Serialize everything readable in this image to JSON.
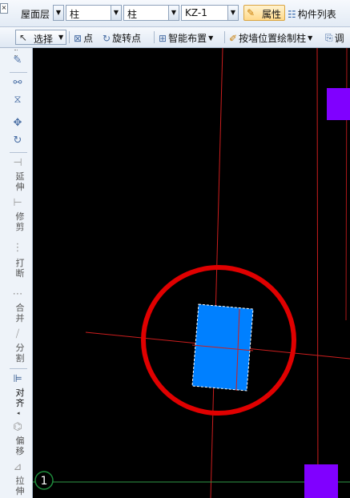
{
  "toolbar_top": {
    "floor": "屋面层",
    "category": "柱",
    "type": "柱",
    "element": "KZ-1",
    "properties": "属性",
    "component_list": "构件列表"
  },
  "toolbar_draw": {
    "select": "选择",
    "point": "点",
    "rotate_point": "旋转点",
    "smart_layout": "智能布置",
    "draw_by_wall": "按墙位置绘制柱",
    "adjust": "调"
  },
  "left_tools": {
    "extend": "延伸",
    "trim": "修剪",
    "break": "打断",
    "merge": "合并",
    "split": "分割",
    "align": "对齐",
    "offset": "偏移",
    "stretch": "拉伸"
  },
  "canvas": {
    "axis_label": "1",
    "colors": {
      "background": "#000000",
      "axis_line": "#cc1e1e",
      "selected_column": "#0080ff",
      "other_column": "#8000ff",
      "highlight_circle": "#e00000",
      "axis_bubble": "#1e8c3c"
    }
  }
}
